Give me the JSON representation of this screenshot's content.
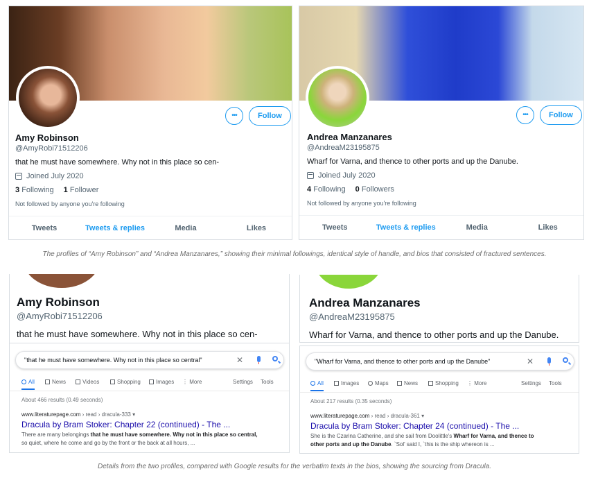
{
  "profiles": [
    {
      "name": "Amy Robinson",
      "handle": "@AmyRobi71512206",
      "bio": "that he must have somewhere. Why not in this place so cen-",
      "joined": "Joined July 2020",
      "following_count": "3",
      "following_label": "Following",
      "followers_count": "1",
      "followers_label": "Follower",
      "not_followed": "Not followed by anyone you're following",
      "more_label": "•••",
      "follow_label": "Follow",
      "tabs": [
        "Tweets",
        "Tweets & replies",
        "Media",
        "Likes"
      ],
      "active_tab": 1
    },
    {
      "name": "Andrea Manzanares",
      "handle": "@AndreaM23195875",
      "bio": "Wharf for Varna, and thence to other ports and up the Danube.",
      "joined": "Joined July 2020",
      "following_count": "4",
      "following_label": "Following",
      "followers_count": "0",
      "followers_label": "Followers",
      "not_followed": "Not followed by anyone you're following",
      "more_label": "•••",
      "follow_label": "Follow",
      "tabs": [
        "Tweets",
        "Tweets & replies",
        "Media",
        "Likes"
      ],
      "active_tab": 1
    }
  ],
  "caption_top": "The profiles of “Amy Robinson” and “Andrea Manzanares,” showing their minimal followings, identical style of handle, and bios that consisted of fractured sentences.",
  "searches": [
    {
      "name": "Amy Robinson",
      "handle": "@AmyRobi71512206",
      "bio": "that he must have somewhere. Why not in this place so cen-",
      "query": "\"that he must have somewhere. Why not in this place so central\"",
      "tabs": [
        "All",
        "News",
        "Videos",
        "Shopping",
        "Images",
        "More"
      ],
      "settings": "Settings",
      "tools": "Tools",
      "about": "About 466 results (0.49 seconds)",
      "url_host": "www.literaturepage.com",
      "url_path": " › read › dracula-333 ▾",
      "title": "Dracula by Bram Stoker: Chapter 22 (continued) - The ...",
      "snippet_1a": "There are many belongings ",
      "snippet_1b": "that he must have somewhere. Why not in this place so central",
      "snippet_1c": ",",
      "snippet_2": "so quiet, where he come and go by the front or the back at all hours, ..."
    },
    {
      "name": "Andrea Manzanares",
      "handle": "@AndreaM23195875",
      "bio": "Wharf for Varna, and thence to other ports and up the Danube.",
      "query": "\"Wharf for Varna, and thence to other ports and up the Danube\"",
      "tabs": [
        "All",
        "Images",
        "Maps",
        "News",
        "Shopping",
        "More"
      ],
      "settings": "Settings",
      "tools": "Tools",
      "about": "About 217 results (0.35 seconds)",
      "url_host": "www.literaturepage.com",
      "url_path": " › read › dracula-361 ▾",
      "title": "Dracula by Bram Stoker: Chapter 24 (continued) - The ...",
      "snippet_1a": "She is the Czarina Catherine, and she sail from Doolittle's ",
      "snippet_1b": "Wharf for Varna, and thence to",
      "snippet_1c": "",
      "snippet_2a": "other ports and up the Danube",
      "snippet_2b": ". `Sol' said I, `this is the ship whereon is ..."
    }
  ],
  "caption_bottom": "Details from the two profiles, compared with Google results for the verbatim texts in the bios, showing the sourcing from Dracula."
}
